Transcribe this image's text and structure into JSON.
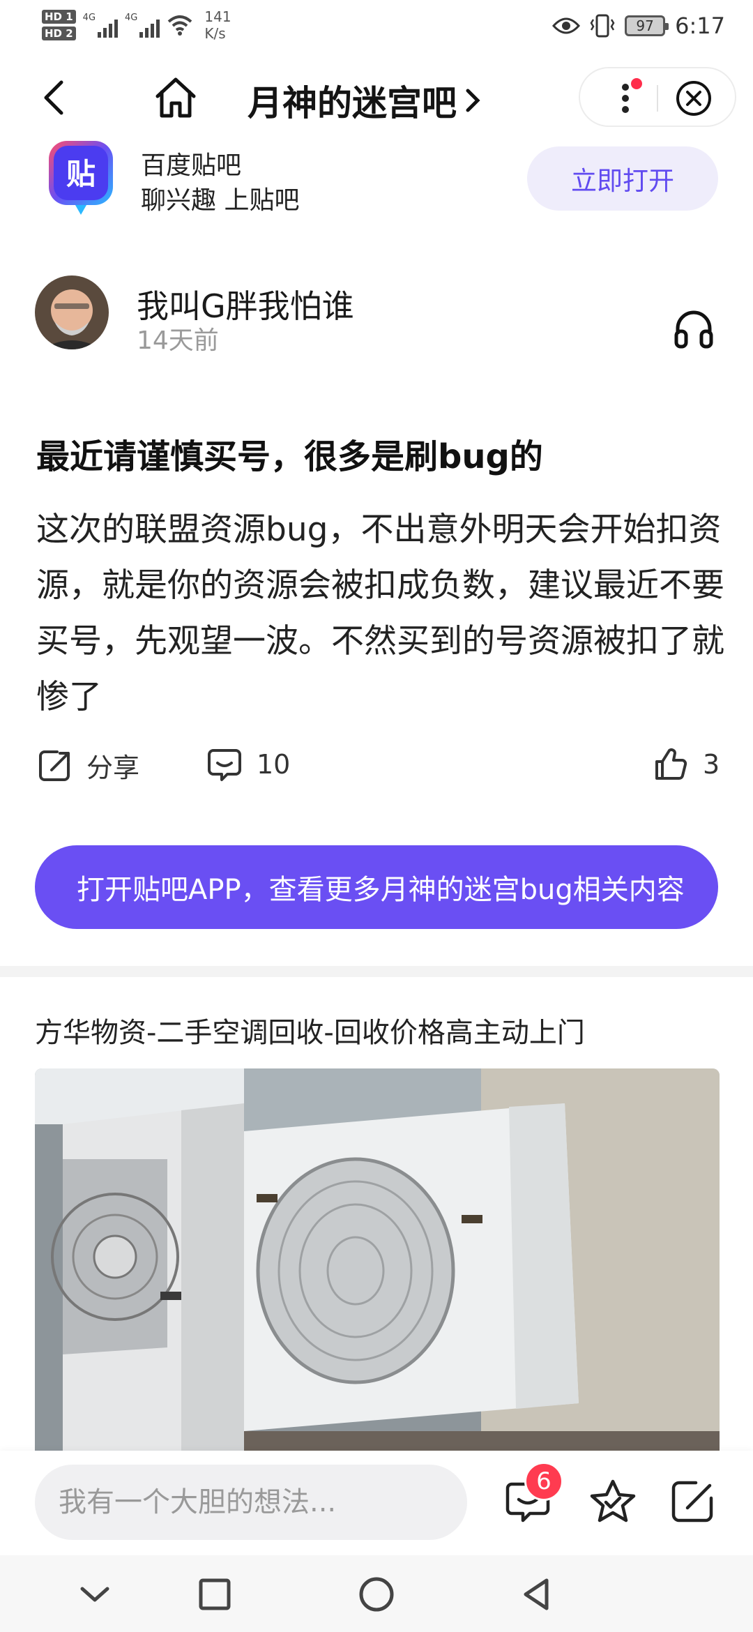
{
  "status_bar": {
    "hd1": "HD 1",
    "hd2": "HD 2",
    "sig1_label": "4G",
    "sig2_label": "4G",
    "net_speed": "141",
    "net_unit": "K/s",
    "battery": "97",
    "time": "6:17"
  },
  "nav": {
    "title": "月神的迷宫吧"
  },
  "app_banner": {
    "name": "百度贴吧",
    "slogan": "聊兴趣 上贴吧",
    "open_label": "立即打开"
  },
  "author": {
    "name": "我叫G胖我怕谁",
    "time": "14天前"
  },
  "post": {
    "title": "最近请谨慎买号，很多是刷bug的",
    "body": "这次的联盟资源bug，不出意外明天会开始扣资源，就是你的资源会被扣成负数，建议最近不要买号，先观望一波。不然买到的号资源被扣了就惨了"
  },
  "actions": {
    "share_label": "分享",
    "comment_count": "10",
    "like_count": "3"
  },
  "cta": {
    "label": "打开贴吧APP，查看更多月神的迷宫bug相关内容"
  },
  "ad": {
    "title": "方华物资-二手空调回收-回收价格高主动上门"
  },
  "bottom_bar": {
    "placeholder": "我有一个大胆的想法...",
    "comment_badge": "6"
  },
  "icons": {
    "back": "chevron-left-icon",
    "home": "home-icon",
    "more": "more-vertical-icon",
    "close": "close-circle-icon",
    "headphone": "headphone-icon",
    "share": "share-icon",
    "comment": "comment-icon",
    "like": "thumbs-up-icon",
    "star": "star-icon",
    "edit": "edit-icon"
  },
  "colors": {
    "accent": "#6a4ff3",
    "accent_light": "#efedfb",
    "badge": "#ff3b50"
  }
}
